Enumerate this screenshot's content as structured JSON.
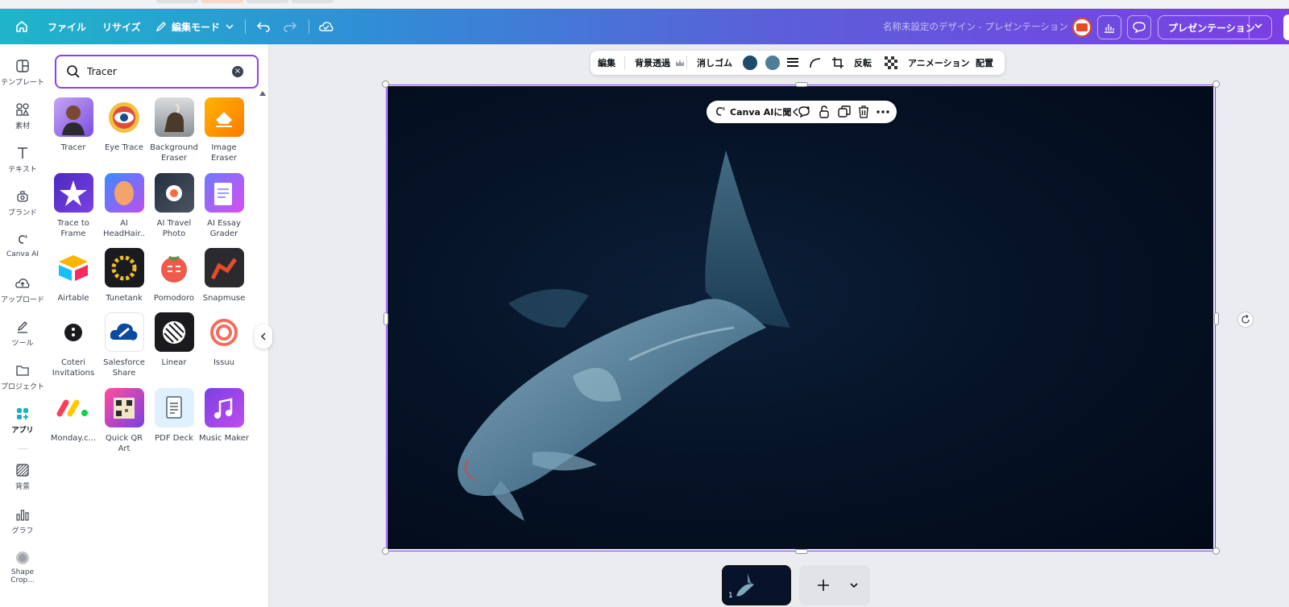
{
  "header": {
    "file_label": "ファイル",
    "resize_label": "リサイズ",
    "edit_mode_label": "編集モード",
    "doc_title": "名称未設定のデザイン - プレゼンテーション",
    "present_label": "プレゼンテーション"
  },
  "rail": {
    "items": [
      {
        "label": "テンプレート",
        "icon": "template-icon"
      },
      {
        "label": "素材",
        "icon": "elements-icon"
      },
      {
        "label": "テキスト",
        "icon": "text-icon"
      },
      {
        "label": "ブランド",
        "icon": "brand-icon"
      },
      {
        "label": "Canva AI",
        "icon": "canva-ai-icon"
      },
      {
        "label": "アップロード",
        "icon": "upload-icon"
      },
      {
        "label": "ツール",
        "icon": "tools-icon"
      },
      {
        "label": "プロジェクト",
        "icon": "folder-icon"
      },
      {
        "label": "アプリ",
        "icon": "apps-icon"
      },
      {
        "label": "背景",
        "icon": "background-icon"
      },
      {
        "label": "グラフ",
        "icon": "chart-icon"
      },
      {
        "label": "Shape Crop...",
        "icon": "shape-crop-icon"
      }
    ]
  },
  "search": {
    "value": "Tracer"
  },
  "apps": [
    {
      "name": "Tracer"
    },
    {
      "name": "Eye Trace"
    },
    {
      "name": "Background Eraser"
    },
    {
      "name": "Image Eraser"
    },
    {
      "name": "Trace to Frame"
    },
    {
      "name": "AI HeadHair.."
    },
    {
      "name": "AI Travel Photo"
    },
    {
      "name": "AI Essay Grader"
    },
    {
      "name": "Airtable"
    },
    {
      "name": "Tunetank"
    },
    {
      "name": "Pomodoro"
    },
    {
      "name": "Snapmuse"
    },
    {
      "name": "Coteri Invitations"
    },
    {
      "name": "Salesforce Share"
    },
    {
      "name": "Linear"
    },
    {
      "name": "Issuu"
    },
    {
      "name": "Monday.c..."
    },
    {
      "name": "Quick QR Art"
    },
    {
      "name": "PDF Deck"
    },
    {
      "name": "Music Maker"
    }
  ],
  "toolbar": {
    "edit_label": "編集",
    "bg_remove_label": "背景透過",
    "eraser_label": "消しゴム",
    "flip_label": "反転",
    "animation_label": "アニメーション",
    "position_label": "配置",
    "color_1": "#1e4a6b",
    "color_2": "#4d7e95"
  },
  "float_bar": {
    "ask_ai_label": "Canva AIに聞く"
  },
  "pages": {
    "current_page": "1"
  }
}
